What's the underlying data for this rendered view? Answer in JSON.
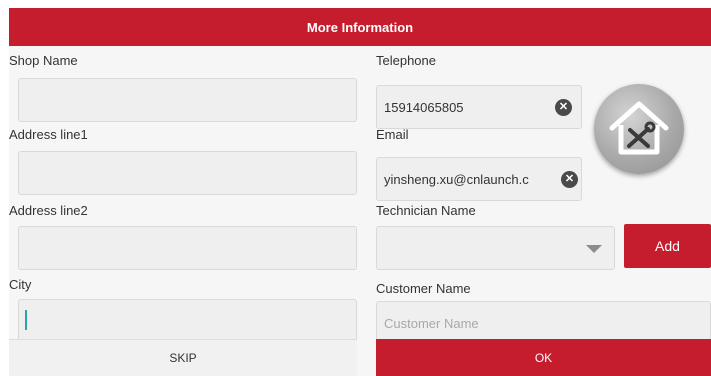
{
  "dialog": {
    "title": "More Information"
  },
  "form": {
    "shop_name": {
      "label": "Shop Name",
      "value": ""
    },
    "address_line1": {
      "label": "Address line1",
      "value": ""
    },
    "address_line2": {
      "label": "Address line2",
      "value": ""
    },
    "city": {
      "label": "City",
      "value": ""
    },
    "telephone": {
      "label": "Telephone",
      "value": "15914065805"
    },
    "email": {
      "label": "Email",
      "value": "yinsheng.xu@cnlaunch.c"
    },
    "technician_name": {
      "label": "Technician Name",
      "selected": ""
    },
    "customer_name": {
      "label": "Customer Name",
      "value": "",
      "placeholder": "Customer Name"
    }
  },
  "buttons": {
    "add_label": "Add",
    "skip_label": "SKIP",
    "ok_label": "OK"
  },
  "icons": {
    "clear": "clear-icon",
    "dropdown": "chevron-down-icon",
    "shop": "shop-repair-icon"
  },
  "colors": {
    "accent": "#c61d2e",
    "field_bg": "#efefef",
    "page_bg": "#f6f6f6"
  }
}
